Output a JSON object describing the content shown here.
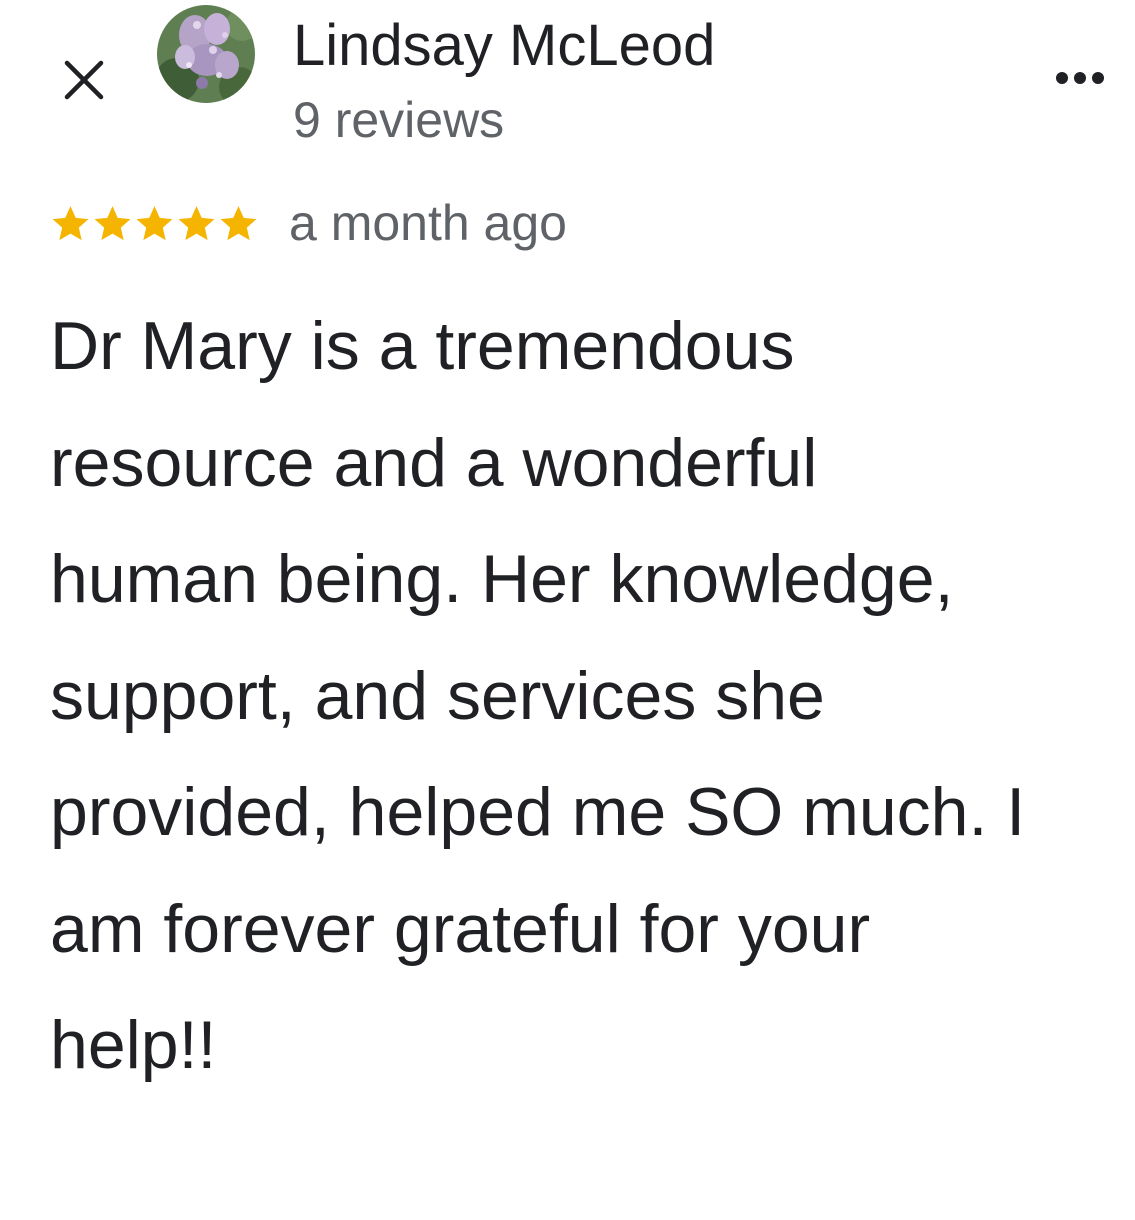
{
  "header": {
    "close_icon": "close-icon",
    "avatar_icon": "avatar-photo",
    "more_icon": "more-horizontal-icon"
  },
  "reviewer": {
    "name": "Lindsay McLeod",
    "review_count": "9 reviews"
  },
  "review": {
    "rating": 5,
    "max_rating": 5,
    "star_color": "#f4b400",
    "date": "a month ago",
    "text": "Dr Mary is a tremendous resource and a wonderful human being. Her knowledge, support, and services she provided, helped me SO much. I am forever grateful for your help!!"
  }
}
